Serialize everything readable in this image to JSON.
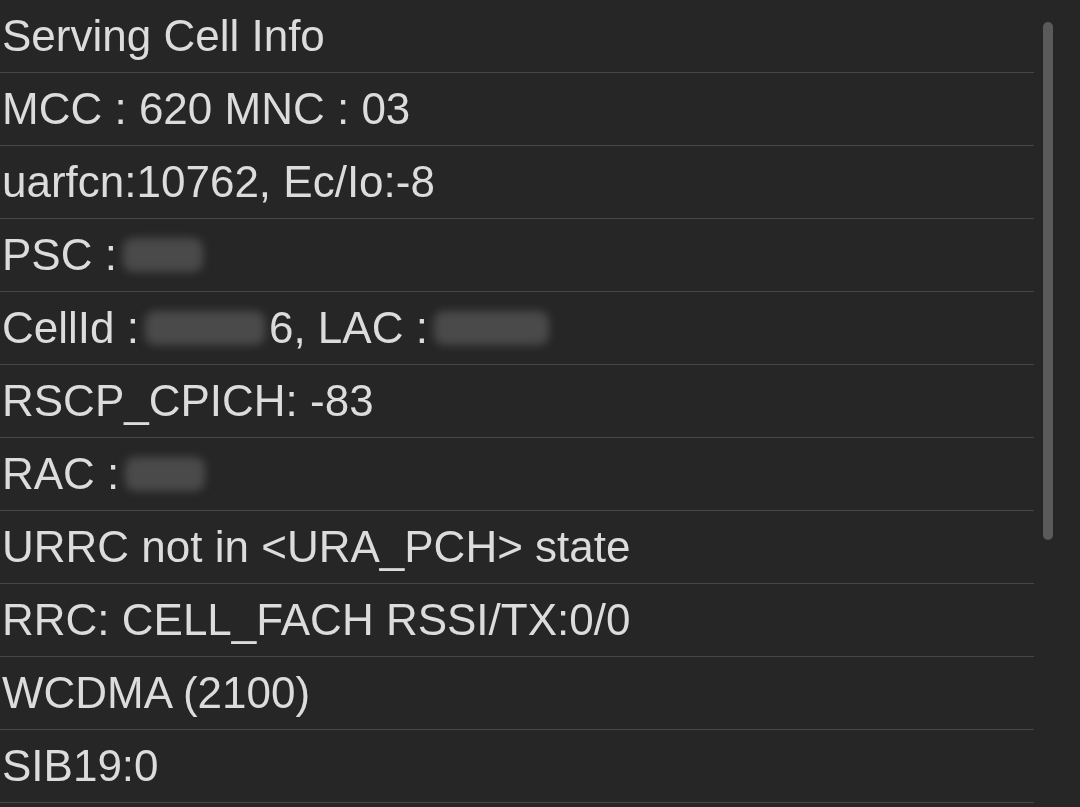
{
  "rows": [
    {
      "parts": [
        {
          "kind": "text",
          "text": "Serving Cell Info"
        }
      ]
    },
    {
      "parts": [
        {
          "kind": "text",
          "text": "MCC : 620 MNC : 03"
        }
      ]
    },
    {
      "parts": [
        {
          "kind": "text",
          "text": "uarfcn:10762, Ec/Io:-8"
        }
      ]
    },
    {
      "parts": [
        {
          "kind": "text",
          "text": "PSC :"
        },
        {
          "kind": "redacted"
        }
      ]
    },
    {
      "parts": [
        {
          "kind": "text",
          "text": "CellId :"
        },
        {
          "kind": "redacted"
        },
        {
          "kind": "text",
          "text": "6, LAC :"
        },
        {
          "kind": "redacted"
        }
      ]
    },
    {
      "parts": [
        {
          "kind": "text",
          "text": "RSCP_CPICH: -83"
        }
      ]
    },
    {
      "parts": [
        {
          "kind": "text",
          "text": "RAC :"
        },
        {
          "kind": "redacted"
        }
      ]
    },
    {
      "parts": [
        {
          "kind": "text",
          "text": "URRC not in <URA_PCH> state"
        }
      ]
    },
    {
      "parts": [
        {
          "kind": "text",
          "text": "RRC: CELL_FACH RSSI/TX:0/0"
        }
      ]
    },
    {
      "parts": [
        {
          "kind": "text",
          "text": "WCDMA (2100)"
        }
      ]
    },
    {
      "parts": [
        {
          "kind": "text",
          "text": "SIB19:0"
        }
      ]
    }
  ]
}
